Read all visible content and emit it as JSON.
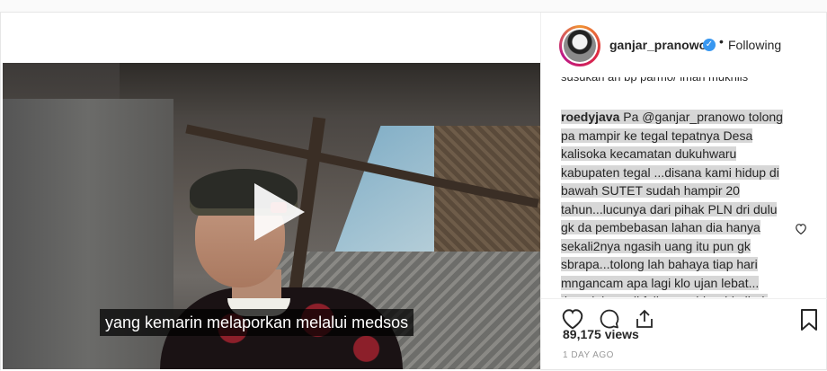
{
  "post": {
    "video": {
      "subtitle": "yang kemarin melaporkan melalui medsos",
      "play_icon": "play-icon"
    },
    "header": {
      "username": "ganjar_pranowo",
      "verified_icon": "verified-badge-icon",
      "separator": "•",
      "follow_status": "Following"
    },
    "comments": {
      "previous_tail": "susukan an bp parmo/ iman mukhlis",
      "items": [
        {
          "username": "roedyjava",
          "text": "Pa @ganjar_pranowo tolong pa mampir ke tegal tepatnya Desa kalisoka kecamatan dukuhwaru kabupaten tegal ...disana kami hidup di bawah SUTET sudah hampir 20 tahun...lucunya dari pihak PLN dri dulu gk da pembebasan lahan dia hanya sekali2nya ngasih uang itu pun gk sbrapa...tolong lah bahaya tiap hari mngancam apa lagi klo ujan lebat... tlong lah pa di follow up biar dri pihak PLN ada tanggung jwabnya apa harus"
        }
      ]
    },
    "actions": {
      "like_icon": "heart-icon",
      "comment_icon": "comment-icon",
      "share_icon": "share-icon",
      "save_icon": "bookmark-icon"
    },
    "views": "89,175 views",
    "timestamp": "1 DAY AGO"
  },
  "colors": {
    "text": "#262626",
    "muted": "#999999",
    "verified": "#3897f0",
    "comment_highlight": "#d7d7d7"
  }
}
